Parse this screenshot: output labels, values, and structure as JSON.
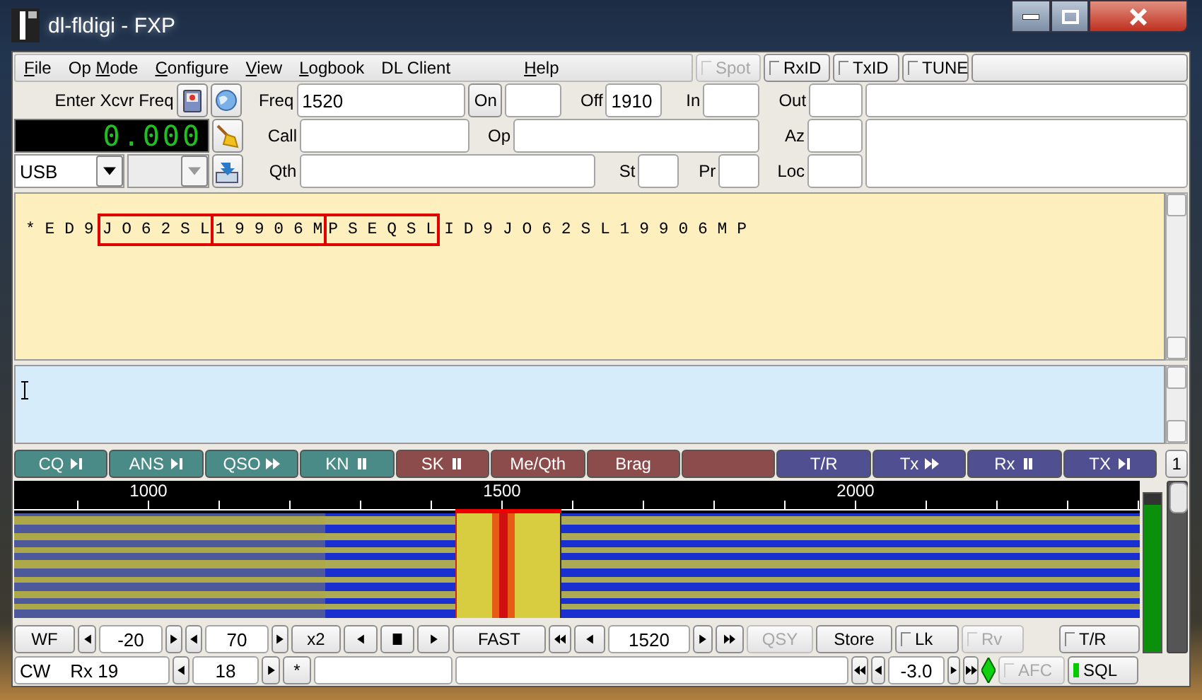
{
  "window": {
    "title": "dl-fldigi - FXP"
  },
  "menu": [
    {
      "key": "F",
      "after": "ile"
    },
    {
      "before": "Op ",
      "key": "M",
      "after": "ode"
    },
    {
      "key": "C",
      "after": "onfigure"
    },
    {
      "key": "V",
      "after": "iew"
    },
    {
      "key": "L",
      "after": "ogbook"
    },
    {
      "before": "DL Client"
    },
    {
      "key": "H",
      "after": "elp"
    }
  ],
  "toggles": [
    {
      "label": "Spot",
      "checked": false,
      "disabled": true
    },
    {
      "label": "RxID",
      "checked": false,
      "disabled": false
    },
    {
      "label": "TxID",
      "checked": false,
      "disabled": false
    },
    {
      "label": "TUNE",
      "checked": false,
      "disabled": false
    }
  ],
  "qso": {
    "xcvr_label": "Enter Xcvr Freq",
    "freq_display": "0.000",
    "mode": "USB",
    "submode_disabled": true,
    "freq": {
      "label": "Freq",
      "value": "1520"
    },
    "on_button": "On",
    "off": {
      "label": "Off",
      "value": "1910"
    },
    "in": {
      "label": "In"
    },
    "out": {
      "label": "Out"
    },
    "call": {
      "label": "Call"
    },
    "op": {
      "label": "Op"
    },
    "az": {
      "label": "Az"
    },
    "qth": {
      "label": "Qth"
    },
    "st": {
      "label": "St"
    },
    "pr": {
      "label": "Pr"
    },
    "loc": {
      "label": "Loc"
    }
  },
  "rx_text": [
    {
      "text": "* E D 9",
      "boxed": false
    },
    {
      "text": "J O 6 2 S L",
      "boxed": true
    },
    {
      "text": "1 9 9 0 6 M",
      "boxed": true
    },
    {
      "text": "P S E Q S L",
      "boxed": true
    },
    {
      "text": "I D 9 J O 6 2 S L 1 9 9 0 6 M P",
      "boxed": false
    }
  ],
  "macros": [
    {
      "label": "CQ",
      "color": "#4a8a87"
    },
    {
      "label": "ANS",
      "color": "#4a8a87"
    },
    {
      "label": "QSO",
      "color": "#4a8a87"
    },
    {
      "label": "KN",
      "color": "#4a8a87"
    },
    {
      "label": "SK",
      "color": "#8c4c4b"
    },
    {
      "label": "Me/Qth",
      "color": "#8c4c4b"
    },
    {
      "label": "Brag",
      "color": "#8c4c4b"
    },
    {
      "color": "#8c4c4b"
    },
    {
      "label": "T/R",
      "color": "#4f4f92"
    },
    {
      "label": "Tx",
      "color": "#4f4f92"
    },
    {
      "label": "Rx",
      "color": "#4f4f92"
    },
    {
      "label": "TX",
      "color": "#4f4f92"
    }
  ],
  "macro_page": "1",
  "scale_labels": [
    "1000",
    "1500",
    "2000"
  ],
  "signal_meter": {
    "level": 0.93
  },
  "squelch_slider": {
    "level": 1
  },
  "controls_row": [
    {
      "kind": "button",
      "label": "WF",
      "disabled": false
    },
    {
      "kind": "left-arrow"
    },
    {
      "kind": "value",
      "value": "-20"
    },
    {
      "kind": "right-arrow"
    },
    {
      "kind": "left-arrow"
    },
    {
      "kind": "value",
      "value": "70"
    },
    {
      "kind": "right-arrow"
    },
    {
      "kind": "button",
      "label": "x2",
      "disabled": false
    },
    {
      "kind": "left-arrow"
    },
    {
      "kind": "stop"
    },
    {
      "kind": "right-arrow"
    },
    {
      "kind": "button",
      "label": "FAST",
      "disabled": false
    },
    {
      "kind": "double-left-arrow"
    },
    {
      "kind": "left-arrow"
    },
    {
      "kind": "value",
      "value": "1520"
    },
    {
      "kind": "right-arrow"
    },
    {
      "kind": "double-right-arrow"
    },
    {
      "kind": "button",
      "label": "QSY",
      "disabled": true
    },
    {
      "kind": "button",
      "label": "Store",
      "disabled": false
    },
    {
      "kind": "check",
      "label": "Lk",
      "checked": false,
      "disabled": false
    },
    {
      "kind": "check",
      "label": "Rv",
      "checked": false,
      "disabled": true
    },
    {
      "kind": "check",
      "label": "T/R",
      "checked": false,
      "disabled": false
    }
  ],
  "status_row": [
    {
      "kind": "status",
      "mode": "CW",
      "rx": "Rx 19"
    },
    {
      "kind": "left-arrow"
    },
    {
      "kind": "value",
      "value": "18"
    },
    {
      "kind": "right-arrow"
    },
    {
      "kind": "button",
      "label": "*",
      "disabled": false
    },
    {
      "kind": "field"
    },
    {
      "kind": "field"
    },
    {
      "kind": "double-left-arrow"
    },
    {
      "kind": "left-arrow"
    },
    {
      "kind": "value",
      "value": "-3.0"
    },
    {
      "kind": "right-arrow"
    },
    {
      "kind": "double-right-arrow"
    },
    {
      "kind": "diamond"
    },
    {
      "kind": "check",
      "label": "AFC",
      "checked": false,
      "disabled": true
    },
    {
      "kind": "light",
      "label": "SQL",
      "on": true
    }
  ]
}
